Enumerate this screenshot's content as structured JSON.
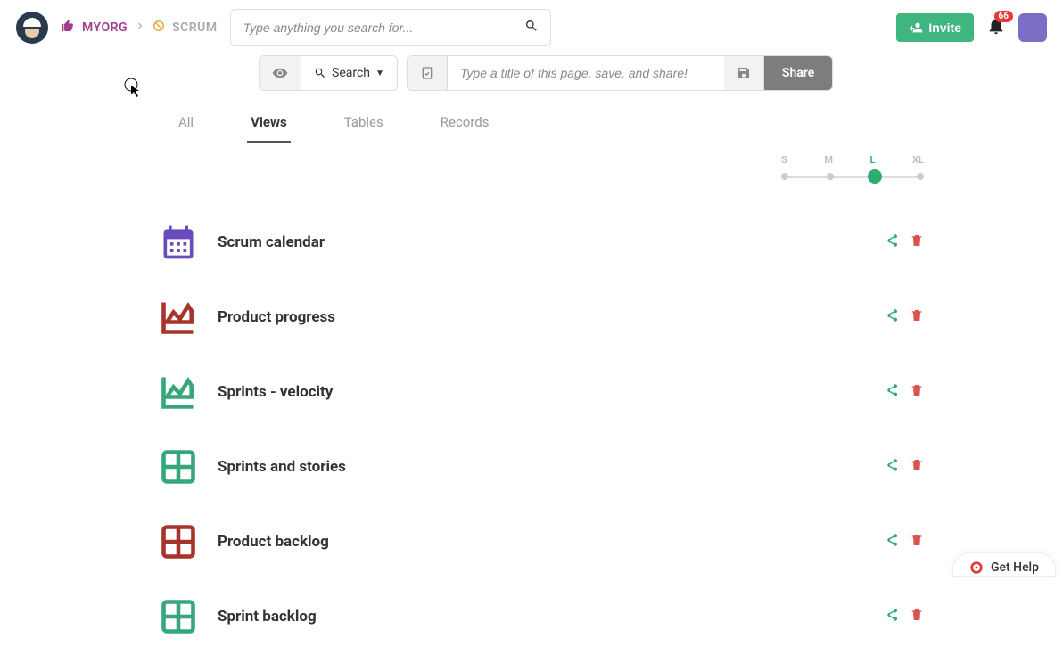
{
  "breadcrumb": {
    "org": "MYORG",
    "project": "SCRUM"
  },
  "search": {
    "placeholder": "Type anything you search for..."
  },
  "toolbar": {
    "search_label": "Search",
    "title_placeholder": "Type a title of this page, save, and share!",
    "share_label": "Share",
    "invite_label": "Invite"
  },
  "notifications": {
    "count": "66"
  },
  "tabs": [
    "All",
    "Views",
    "Tables",
    "Records"
  ],
  "active_tab": 1,
  "size": {
    "labels": [
      "S",
      "M",
      "L",
      "XL"
    ],
    "active": 2
  },
  "items": [
    {
      "title": "Scrum calendar",
      "icon": "calendar",
      "color": "#6a4bbc"
    },
    {
      "title": "Product progress",
      "icon": "chart",
      "color": "#a7342a"
    },
    {
      "title": "Sprints - velocity",
      "icon": "chart",
      "color": "#36a77a"
    },
    {
      "title": "Sprints and stories",
      "icon": "grid",
      "color": "#36a77a"
    },
    {
      "title": "Product backlog",
      "icon": "grid",
      "color": "#a7342a"
    },
    {
      "title": "Sprint backlog",
      "icon": "grid",
      "color": "#36a77a"
    }
  ],
  "help": {
    "label": "Get Help"
  }
}
